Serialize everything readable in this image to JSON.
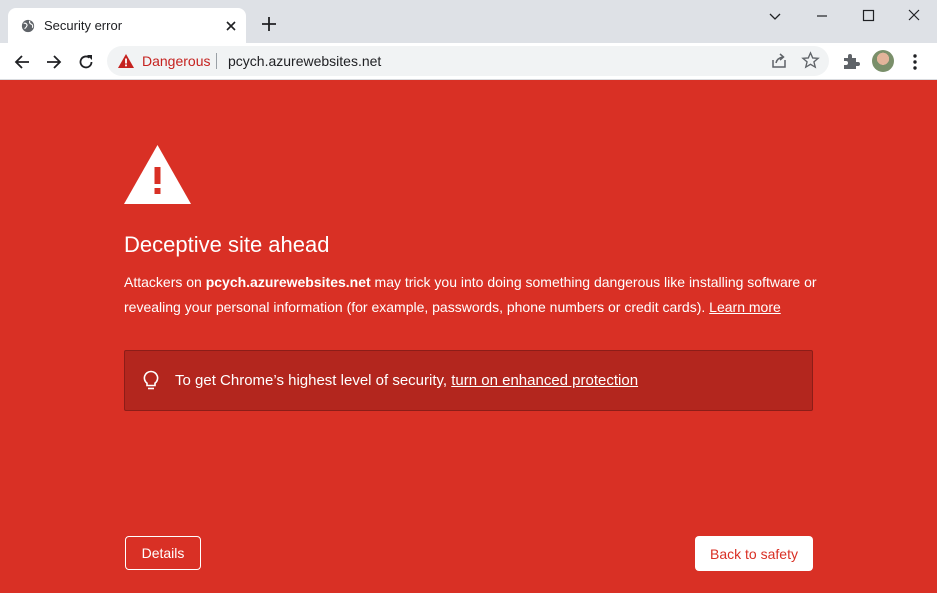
{
  "browser": {
    "tab_title": "Security error",
    "security_chip": "Dangerous",
    "url": "pcych.azurewebsites.net"
  },
  "icons": [
    "globe-icon",
    "close-icon",
    "plus-icon",
    "chevron-down-icon",
    "minimize-icon",
    "maximize-icon",
    "close-window-icon",
    "back-arrow-icon",
    "forward-arrow-icon",
    "reload-icon",
    "warning-icon",
    "share-icon",
    "star-icon",
    "extensions-puzzle-icon",
    "avatar",
    "kebab-menu-icon",
    "lightbulb-icon"
  ],
  "colors": {
    "background": "#d93025",
    "tip_box": "#b3261e",
    "danger_text": "#c5221f"
  },
  "page": {
    "heading": "Deceptive site ahead",
    "desc_prefix": "Attackers on ",
    "desc_domain": "pcych.azurewebsites.net",
    "desc_suffix": " may trick you into doing something dangerous like installing software or revealing your personal information (for example, passwords, phone numbers or credit cards). ",
    "learn_more": "Learn more",
    "tip_prefix": "To get Chrome’s highest level of security, ",
    "tip_link": "turn on enhanced protection",
    "details_button": "Details",
    "back_button": "Back to safety"
  }
}
